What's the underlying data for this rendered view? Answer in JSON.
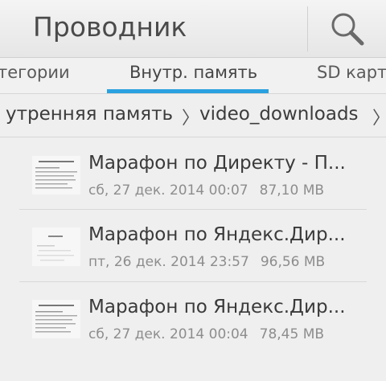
{
  "app": {
    "title": "Проводник",
    "search_icon": "search-icon"
  },
  "tabs": [
    {
      "label": "тегории",
      "active": false
    },
    {
      "label": "Внутр. память",
      "active": true
    },
    {
      "label": "SD карт",
      "active": false
    }
  ],
  "accent_color": "#2aa1e0",
  "breadcrumb": {
    "items": [
      "утренняя память",
      "video_downloads"
    ],
    "separator": "〉"
  },
  "files": [
    {
      "name": "Марафон по Директу - П...",
      "date": "сб, 27 дек. 2014 00:07",
      "size": "87,10 MB",
      "thumb": "document-thumbnail"
    },
    {
      "name": "Марафон по Яндекс.Дир...",
      "date": "пт, 26 дек. 2014 23:57",
      "size": "96,56 MB",
      "thumb": "document-thumbnail"
    },
    {
      "name": "Марафон по Яндекс.Дир...",
      "date": "сб, 27 дек. 2014 00:04",
      "size": "78,45 MB",
      "thumb": "document-thumbnail"
    }
  ]
}
